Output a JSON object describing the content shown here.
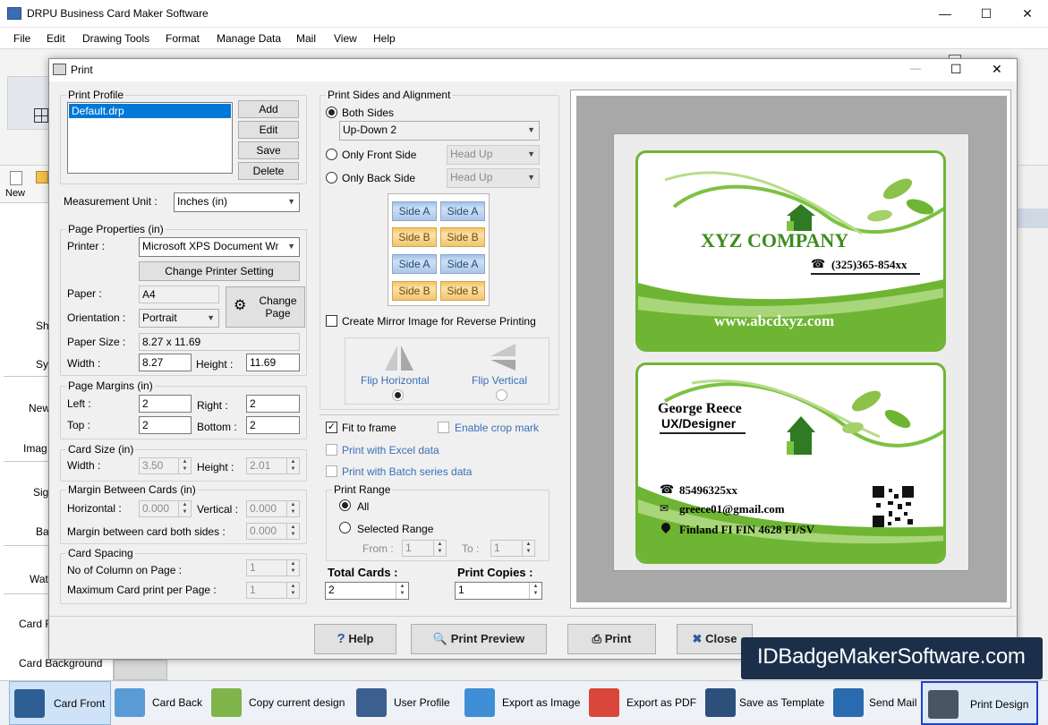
{
  "app": {
    "title": "DRPU Business Card Maker Software"
  },
  "menu": [
    "File",
    "Edit",
    "Drawing Tools",
    "Format",
    "Manage Data",
    "Mail",
    "View",
    "Help"
  ],
  "left_panel": {
    "new_label": "New",
    "items": [
      "Sh",
      "Sy",
      "New",
      "Imag",
      "Sig",
      "Ba",
      "Wat",
      "Card F",
      "Card Background"
    ]
  },
  "dialog": {
    "title": "Print",
    "print_profile": {
      "title": "Print Profile",
      "selected": "Default.drp",
      "buttons": {
        "add": "Add",
        "edit": "Edit",
        "save": "Save",
        "delete": "Delete"
      }
    },
    "measurement": {
      "label": "Measurement Unit :",
      "value": "Inches (in)"
    },
    "page_properties": {
      "title": "Page Properties (in)",
      "printer_label": "Printer :",
      "printer_value": "Microsoft XPS Document Wr",
      "change_printer": "Change Printer Setting",
      "paper_label": "Paper :",
      "paper_value": "A4",
      "change_page": "Change Page",
      "orientation_label": "Orientation :",
      "orientation_value": "Portrait",
      "paper_size_label": "Paper Size :",
      "paper_size_value": "8.27 x 11.69",
      "width_label": "Width :",
      "width_value": "8.27",
      "height_label": "Height :",
      "height_value": "11.69"
    },
    "page_margins": {
      "title": "Page Margins (in)",
      "left_label": "Left :",
      "left": "2",
      "right_label": "Right :",
      "right": "2",
      "top_label": "Top :",
      "top": "2",
      "bottom_label": "Bottom :",
      "bottom": "2"
    },
    "card_size": {
      "title": "Card Size (in)",
      "width_label": "Width :",
      "width": "3.50",
      "height_label": "Height :",
      "height": "2.01"
    },
    "margin_between": {
      "title": "Margin Between Cards (in)",
      "horizontal_label": "Horizontal :",
      "horizontal": "0.000",
      "vertical_label": "Vertical :",
      "vertical": "0.000",
      "both_label": "Margin between card both sides :",
      "both": "0.000"
    },
    "card_spacing": {
      "title": "Card Spacing",
      "columns_label": "No of Column on Page :",
      "columns": "1",
      "max_label": "Maximum Card print per Page :",
      "max": "1"
    },
    "sides": {
      "title": "Print Sides and Alignment",
      "both_label": "Both Sides",
      "both_value": "Up-Down 2",
      "front_label": "Only Front Side",
      "front_value": "Head Up",
      "back_label": "Only Back Side",
      "back_value": "Head Up",
      "side_a": "Side A",
      "side_b": "Side B",
      "mirror_label": "Create Mirror Image for Reverse Printing",
      "flip_h": "Flip Horizontal",
      "flip_v": "Flip Vertical"
    },
    "options": {
      "fit_label": "Fit to frame",
      "fit_checked": true,
      "crop_label": "Enable crop mark",
      "excel_label": "Print with Excel data",
      "batch_label": "Print with Batch series data"
    },
    "range": {
      "title": "Print Range",
      "all_label": "All",
      "selected_label": "Selected Range",
      "from_label": "From :",
      "from": "1",
      "to_label": "To :",
      "to": "1"
    },
    "totals": {
      "total_label": "Total Cards :",
      "total": "2",
      "copies_label": "Print Copies :",
      "copies": "1"
    },
    "buttons": {
      "help": "Help",
      "preview": "Print Preview",
      "print": "Print",
      "close": "Close"
    }
  },
  "card_front": {
    "company": "XYZ COMPANY",
    "phone": "(325)365-854xx",
    "website": "www.abcdxyz.com"
  },
  "card_back": {
    "name": "George Reece",
    "role": "UX/Designer",
    "phone": "85496325xx",
    "email": "greece01@gmail.com",
    "address": "Finland FI FIN 4628 FI/SV"
  },
  "watermark": "IDBadgeMakerSoftware.com",
  "taskbar": [
    "Card Front",
    "Card Back",
    "Copy current design",
    "User Profile",
    "Export as Image",
    "Export as PDF",
    "Save as Template",
    "Send Mail",
    "Print Design"
  ],
  "colors": {
    "card_green": "#6fb534",
    "accent_blue": "#3a6fb6",
    "selection": "#0078d7"
  }
}
